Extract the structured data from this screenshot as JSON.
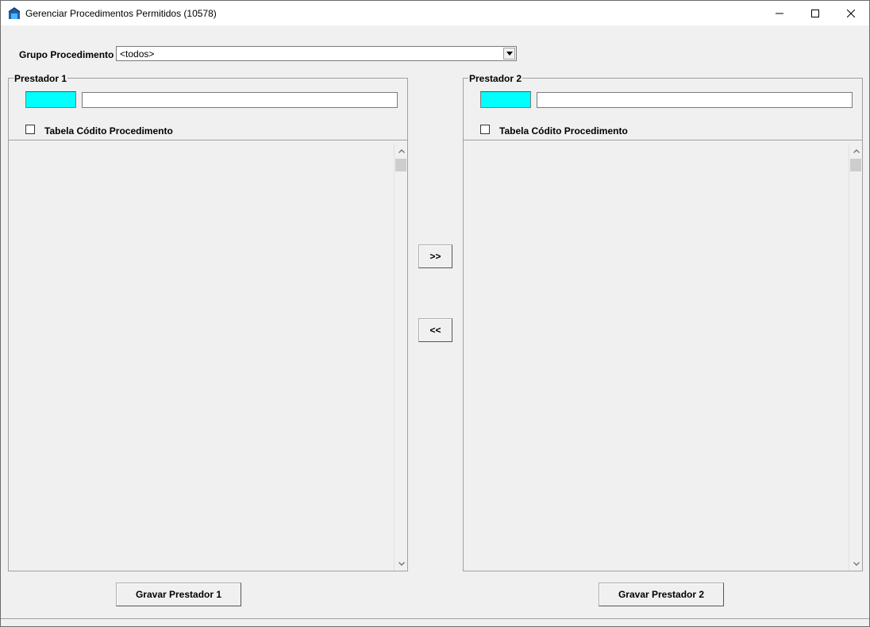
{
  "window": {
    "title": "Gerenciar Procedimentos Permitidos (10578)",
    "icon": "app-icon"
  },
  "filter": {
    "grupo_label": "Grupo Procedimento",
    "grupo_value": "<todos>"
  },
  "prestador1": {
    "legend": "Prestador 1",
    "code_value": "",
    "name_value": "",
    "checkbox_label": "Tabela Códito Procedimento",
    "checkbox_checked": false,
    "save_label": "Gravar Prestador 1"
  },
  "prestador2": {
    "legend": "Prestador 2",
    "code_value": "",
    "name_value": "",
    "checkbox_label": "Tabela Códito Procedimento",
    "checkbox_checked": false,
    "save_label": "Gravar Prestador 2"
  },
  "transfer": {
    "move_right_label": ">>",
    "move_left_label": "<<"
  },
  "colors": {
    "code_field_bg": "#00ffff",
    "window_bg": "#f0f0f0"
  }
}
